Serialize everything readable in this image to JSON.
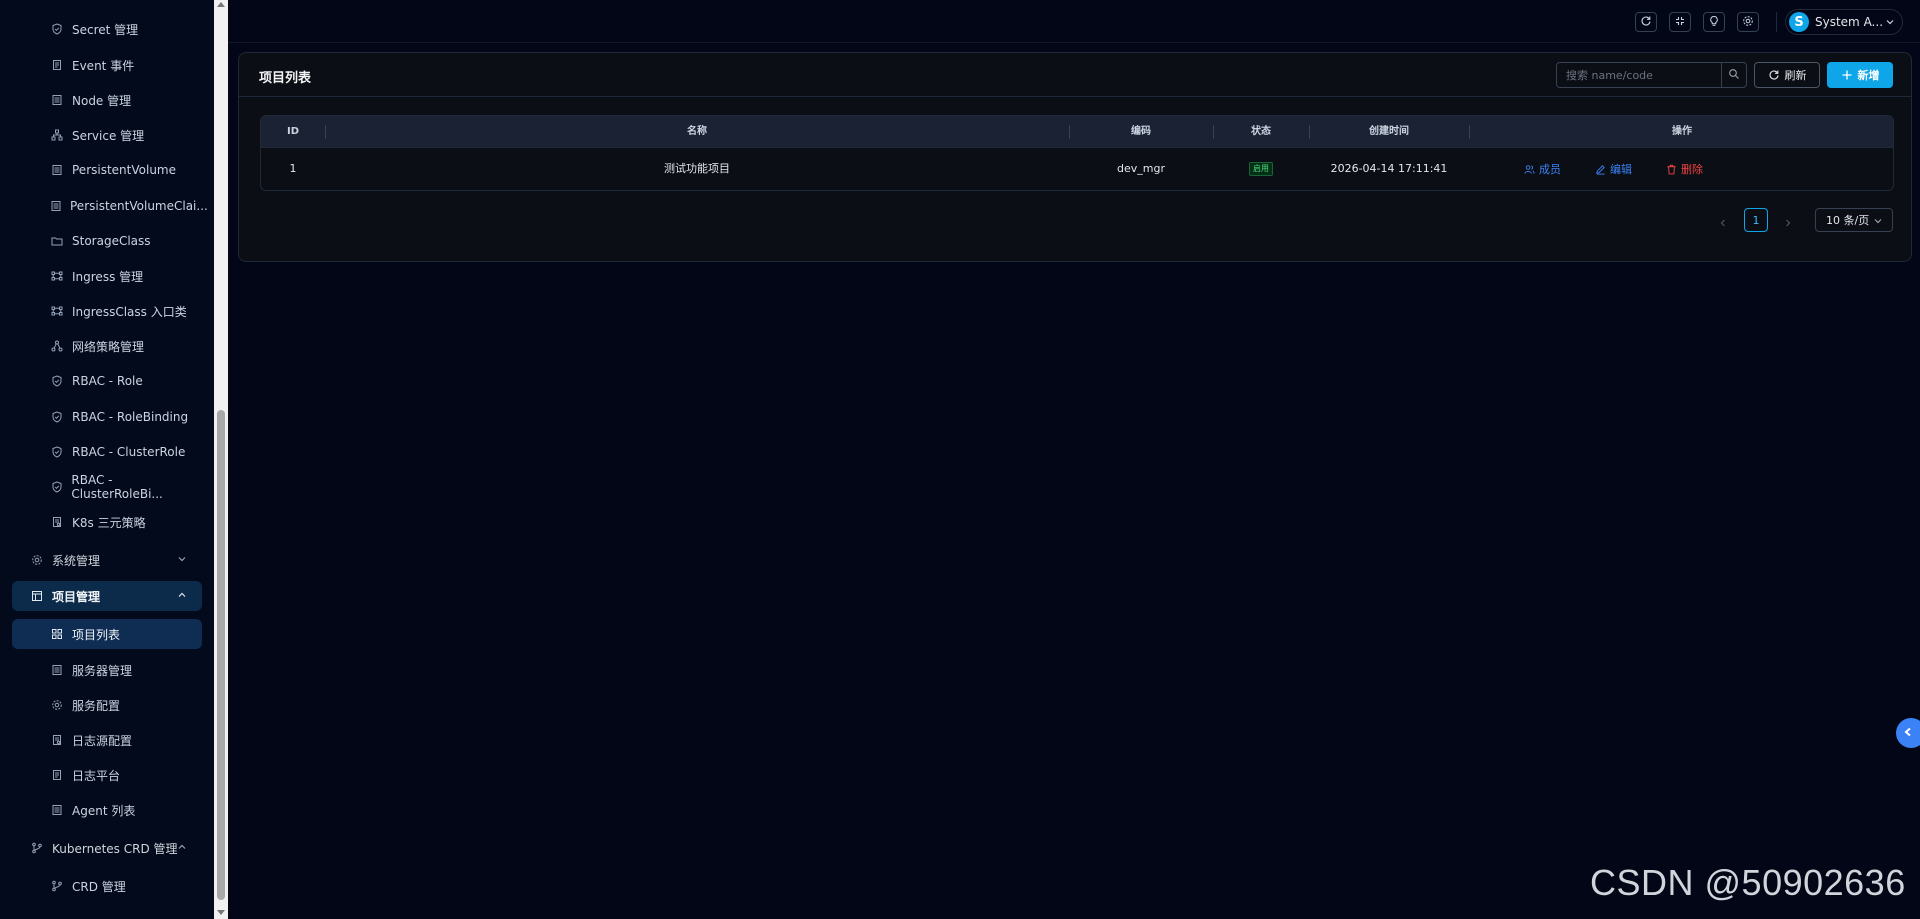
{
  "sidebar": {
    "items": [
      {
        "label": "Secret 管理",
        "icon": "shield-icon"
      },
      {
        "label": "Event 事件",
        "icon": "document-icon"
      },
      {
        "label": "Node 管理",
        "icon": "list-icon"
      },
      {
        "label": "Service 管理",
        "icon": "network-icon"
      },
      {
        "label": "PersistentVolume",
        "icon": "list-icon"
      },
      {
        "label": "PersistentVolumeClai...",
        "icon": "list-icon"
      },
      {
        "label": "StorageClass",
        "icon": "folder-icon"
      },
      {
        "label": "Ingress 管理",
        "icon": "ingress-icon"
      },
      {
        "label": "IngressClass 入口类",
        "icon": "ingress-icon"
      },
      {
        "label": "网络策略管理",
        "icon": "network-icon"
      },
      {
        "label": "RBAC - Role",
        "icon": "shield-icon"
      },
      {
        "label": "RBAC - RoleBinding",
        "icon": "shield-icon"
      },
      {
        "label": "RBAC - ClusterRole",
        "icon": "shield-icon"
      },
      {
        "label": "RBAC - ClusterRoleBi...",
        "icon": "shield-icon"
      },
      {
        "label": "K8s 三元策略",
        "icon": "document-icon"
      }
    ],
    "system_group": "系统管理",
    "project_group": "项目管理",
    "project_items": [
      {
        "label": "项目列表",
        "icon": "grid-icon"
      },
      {
        "label": "服务器管理",
        "icon": "list-icon"
      },
      {
        "label": "服务配置",
        "icon": "gear-icon"
      },
      {
        "label": "日志源配置",
        "icon": "document-icon"
      },
      {
        "label": "日志平台",
        "icon": "document-icon"
      },
      {
        "label": "Agent 列表",
        "icon": "list-icon"
      }
    ],
    "crd_group": "Kubernetes CRD 管理",
    "crd_items": [
      {
        "label": "CRD 管理",
        "icon": "branch-icon"
      }
    ]
  },
  "header": {
    "avatar_letter": "S",
    "user_name": "System A..."
  },
  "card": {
    "title": "项目列表",
    "search_placeholder": "搜索 name/code",
    "refresh_label": "刷新",
    "add_label": "新增"
  },
  "table": {
    "columns": [
      "ID",
      "名称",
      "编码",
      "状态",
      "创建时间",
      "操作"
    ],
    "rows": [
      {
        "id": "1",
        "name": "测试功能项目",
        "code": "dev_mgr",
        "status": "启用",
        "created": "2026-04-14 17:11:41",
        "actions": [
          "成员",
          "编辑",
          "删除"
        ]
      }
    ]
  },
  "pagination": {
    "current": "1",
    "page_size": "10 条/页"
  },
  "watermark": "CSDN @50902636",
  "colors": {
    "accent": "#0ea5e9",
    "link": "#3b82f6",
    "danger": "#ef4444",
    "success": "#4ade80",
    "background": "#020617"
  }
}
